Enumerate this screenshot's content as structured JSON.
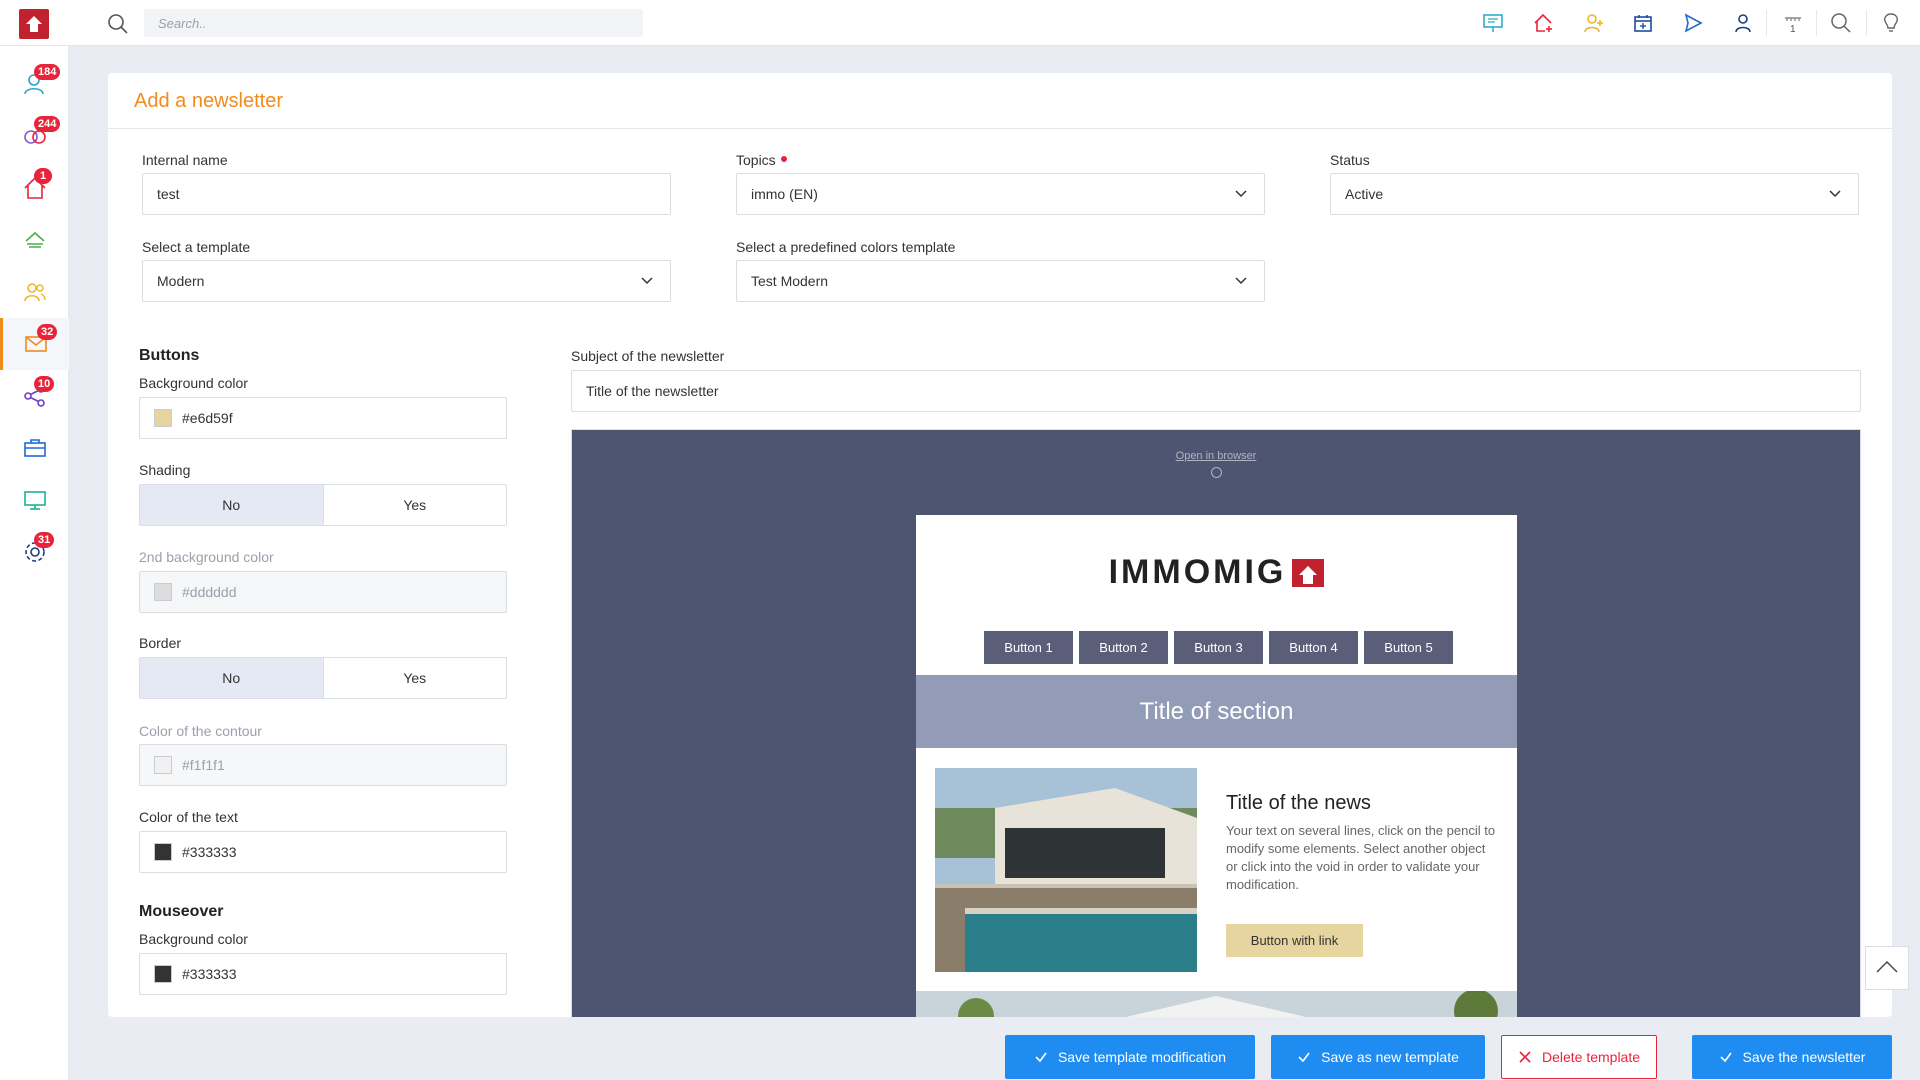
{
  "topbar": {
    "search_placeholder": "Search..",
    "notif_count": "1",
    "icons": [
      "presentation-icon",
      "add-property-icon",
      "add-contact-icon",
      "add-calendar-icon",
      "send-icon",
      "user-icon",
      "notifications-icon",
      "search-icon",
      "lightbulb-icon"
    ]
  },
  "sidebar": {
    "items": [
      {
        "icon": "contacts-icon",
        "badge": "184"
      },
      {
        "icon": "matches-icon",
        "badge": "244"
      },
      {
        "icon": "properties-icon",
        "badge": "1"
      },
      {
        "icon": "leads-icon",
        "badge": ""
      },
      {
        "icon": "team-icon",
        "badge": ""
      },
      {
        "icon": "mail-icon",
        "badge": "32"
      },
      {
        "icon": "share-icon",
        "badge": "10"
      },
      {
        "icon": "portfolio-icon",
        "badge": ""
      },
      {
        "icon": "monitor-icon",
        "badge": ""
      },
      {
        "icon": "settings-icon",
        "badge": "31"
      }
    ]
  },
  "page": {
    "title": "Add a newsletter"
  },
  "form": {
    "internal_name_label": "Internal name",
    "internal_name_value": "test",
    "topics_label": "Topics",
    "topics_value": "immo (EN)",
    "status_label": "Status",
    "status_value": "Active",
    "template_label": "Select a template",
    "template_value": "Modern",
    "colors_template_label": "Select a predefined colors template",
    "colors_template_value": "Test Modern",
    "subject_label": "Subject of the newsletter",
    "subject_value": "Title of the newsletter"
  },
  "buttons_section": {
    "heading": "Buttons",
    "bg_color_label": "Background color",
    "bg_color_value": "#e6d59f",
    "shading_label": "Shading",
    "no_label": "No",
    "yes_label": "Yes",
    "bg2_label": "2nd background color",
    "bg2_value": "#dddddd",
    "border_label": "Border",
    "contour_label": "Color of the contour",
    "contour_value": "#f1f1f1",
    "text_color_label": "Color of the text",
    "text_color_value": "#333333"
  },
  "mouseover_section": {
    "heading": "Mouseover",
    "bg_color_label": "Background color",
    "bg_color_value": "#333333"
  },
  "preview": {
    "open_in_browser": "Open in browser",
    "brand": "IMMOMIG",
    "nav_buttons": [
      "Button 1",
      "Button 2",
      "Button 3",
      "Button 4",
      "Button 5"
    ],
    "section_title": "Title of section",
    "news_title": "Title of the news",
    "news_text": "Your text on several lines, click on the pencil to modify some elements. Select another object or click into the void in order to validate your modification.",
    "news_button": "Button with link"
  },
  "actions": {
    "save_template_mod": "Save template modification",
    "save_new_template": "Save as new template",
    "delete_template": "Delete template",
    "save_newsletter": "Save the newsletter"
  },
  "colors": {
    "accent": "#f28b1c",
    "primary": "#1e8cf0",
    "danger": "#e8243b",
    "preview_bg": "#4e5570",
    "nav_btn": "#5a5e78",
    "section_bg": "#929cb6",
    "swatch_bg": "#e6d59f",
    "swatch_bg2": "#dddddd",
    "swatch_contour": "#f1f1f1",
    "swatch_text": "#333333"
  }
}
